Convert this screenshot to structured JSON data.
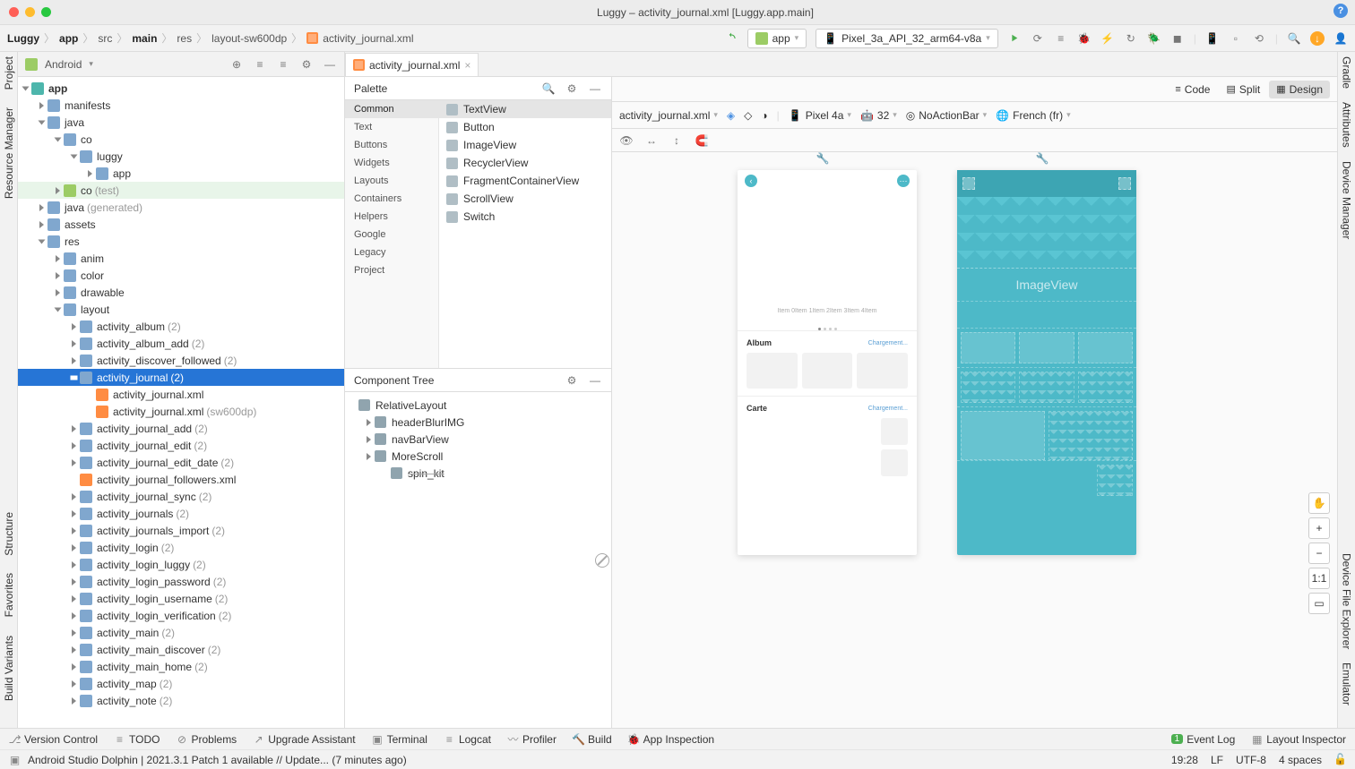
{
  "window_title": "Luggy – activity_journal.xml [Luggy.app.main]",
  "breadcrumb": [
    "Luggy",
    "app",
    "src",
    "main",
    "res",
    "layout-sw600dp",
    "activity_journal.xml"
  ],
  "run_config": "app",
  "device_config": "Pixel_3a_API_32_arm64-v8a",
  "project_selector": "Android",
  "left_rail": {
    "project": "Project",
    "resmgr": "Resource Manager",
    "structure": "Structure",
    "favorites": "Favorites",
    "build": "Build Variants"
  },
  "right_rail": {
    "gradle": "Gradle",
    "attrs": "Attributes",
    "devmgr": "Device Manager",
    "fileexp": "Device File Explorer",
    "emu": "Emulator"
  },
  "tree": [
    {
      "d": 0,
      "ic": "mod",
      "nm": "app",
      "open": true,
      "bold": true
    },
    {
      "d": 1,
      "ic": "fold",
      "nm": "manifests",
      "open": false
    },
    {
      "d": 1,
      "ic": "fold",
      "nm": "java",
      "open": true
    },
    {
      "d": 2,
      "ic": "fold",
      "nm": "co",
      "open": true
    },
    {
      "d": 3,
      "ic": "fold",
      "nm": "luggy",
      "open": true
    },
    {
      "d": 4,
      "ic": "fold",
      "nm": "app",
      "open": false
    },
    {
      "d": 2,
      "ic": "foldg",
      "nm": "co",
      "cnt": "(test)",
      "open": false,
      "hl": true
    },
    {
      "d": 1,
      "ic": "fold",
      "nm": "java",
      "cnt": "(generated)",
      "open": false
    },
    {
      "d": 1,
      "ic": "fold",
      "nm": "assets",
      "open": false
    },
    {
      "d": 1,
      "ic": "fold",
      "nm": "res",
      "open": true
    },
    {
      "d": 2,
      "ic": "fold",
      "nm": "anim",
      "open": false
    },
    {
      "d": 2,
      "ic": "fold",
      "nm": "color",
      "open": false
    },
    {
      "d": 2,
      "ic": "fold",
      "nm": "drawable",
      "open": false
    },
    {
      "d": 2,
      "ic": "fold",
      "nm": "layout",
      "open": true
    },
    {
      "d": 3,
      "ic": "fold",
      "nm": "activity_album",
      "cnt": "(2)",
      "open": false
    },
    {
      "d": 3,
      "ic": "fold",
      "nm": "activity_album_add",
      "cnt": "(2)",
      "open": false
    },
    {
      "d": 3,
      "ic": "fold",
      "nm": "activity_discover_followed",
      "cnt": "(2)",
      "open": false
    },
    {
      "d": 3,
      "ic": "fold",
      "nm": "activity_journal",
      "cnt": "(2)",
      "open": true,
      "sel": true
    },
    {
      "d": 4,
      "ic": "xml",
      "nm": "activity_journal.xml",
      "leaf": true
    },
    {
      "d": 4,
      "ic": "xml",
      "nm": "activity_journal.xml",
      "cnt": "(sw600dp)",
      "leaf": true
    },
    {
      "d": 3,
      "ic": "fold",
      "nm": "activity_journal_add",
      "cnt": "(2)",
      "open": false
    },
    {
      "d": 3,
      "ic": "fold",
      "nm": "activity_journal_edit",
      "cnt": "(2)",
      "open": false
    },
    {
      "d": 3,
      "ic": "fold",
      "nm": "activity_journal_edit_date",
      "cnt": "(2)",
      "open": false
    },
    {
      "d": 3,
      "ic": "xml",
      "nm": "activity_journal_followers.xml",
      "leaf": true
    },
    {
      "d": 3,
      "ic": "fold",
      "nm": "activity_journal_sync",
      "cnt": "(2)",
      "open": false
    },
    {
      "d": 3,
      "ic": "fold",
      "nm": "activity_journals",
      "cnt": "(2)",
      "open": false
    },
    {
      "d": 3,
      "ic": "fold",
      "nm": "activity_journals_import",
      "cnt": "(2)",
      "open": false
    },
    {
      "d": 3,
      "ic": "fold",
      "nm": "activity_login",
      "cnt": "(2)",
      "open": false
    },
    {
      "d": 3,
      "ic": "fold",
      "nm": "activity_login_luggy",
      "cnt": "(2)",
      "open": false
    },
    {
      "d": 3,
      "ic": "fold",
      "nm": "activity_login_password",
      "cnt": "(2)",
      "open": false
    },
    {
      "d": 3,
      "ic": "fold",
      "nm": "activity_login_username",
      "cnt": "(2)",
      "open": false
    },
    {
      "d": 3,
      "ic": "fold",
      "nm": "activity_login_verification",
      "cnt": "(2)",
      "open": false
    },
    {
      "d": 3,
      "ic": "fold",
      "nm": "activity_main",
      "cnt": "(2)",
      "open": false
    },
    {
      "d": 3,
      "ic": "fold",
      "nm": "activity_main_discover",
      "cnt": "(2)",
      "open": false
    },
    {
      "d": 3,
      "ic": "fold",
      "nm": "activity_main_home",
      "cnt": "(2)",
      "open": false
    },
    {
      "d": 3,
      "ic": "fold",
      "nm": "activity_map",
      "cnt": "(2)",
      "open": false
    },
    {
      "d": 3,
      "ic": "fold",
      "nm": "activity_note",
      "cnt": "(2)",
      "open": false
    }
  ],
  "editor_tab": "activity_journal.xml",
  "palette": {
    "title": "Palette",
    "cats": [
      "Common",
      "Text",
      "Buttons",
      "Widgets",
      "Layouts",
      "Containers",
      "Helpers",
      "Google",
      "Legacy",
      "Project"
    ],
    "items": [
      "TextView",
      "Button",
      "ImageView",
      "RecyclerView",
      "FragmentContainerView",
      "ScrollView",
      "Switch"
    ]
  },
  "ctree": {
    "title": "Component Tree",
    "nodes": [
      {
        "d": 0,
        "nm": "RelativeLayout",
        "open": null
      },
      {
        "d": 1,
        "nm": "headerBlurIMG",
        "open": false
      },
      {
        "d": 1,
        "nm": "navBarView",
        "open": false
      },
      {
        "d": 1,
        "nm": "MoreScroll",
        "open": false
      },
      {
        "d": 2,
        "nm": "spin_kit",
        "strike": true,
        "leaf": true
      }
    ]
  },
  "design_toolbar": {
    "code": "Code",
    "split": "Split",
    "design": "Design",
    "file": "activity_journal.xml",
    "device": "Pixel 4a",
    "api": "32",
    "theme": "NoActionBar",
    "locale": "French (fr)"
  },
  "preview": {
    "items_text": "Item 0Item 1Item 2Item 3Item 4Item",
    "album": "Album",
    "carte": "Carte",
    "loading": "Chargement...",
    "imageview": "ImageView"
  },
  "zoom": {
    "fit": "1:1"
  },
  "bottom_tools": {
    "vc": "Version Control",
    "todo": "TODO",
    "problems": "Problems",
    "upgrade": "Upgrade Assistant",
    "terminal": "Terminal",
    "logcat": "Logcat",
    "profiler": "Profiler",
    "build": "Build",
    "inspect": "App Inspection",
    "eventlog": "Event Log",
    "layoutinsp": "Layout Inspector"
  },
  "status": {
    "msg": "Android Studio Dolphin | 2021.3.1 Patch 1 available // Update... (7 minutes ago)",
    "time": "19:28",
    "le": "LF",
    "enc": "UTF-8",
    "indent": "4 spaces",
    "event_count": "1"
  }
}
